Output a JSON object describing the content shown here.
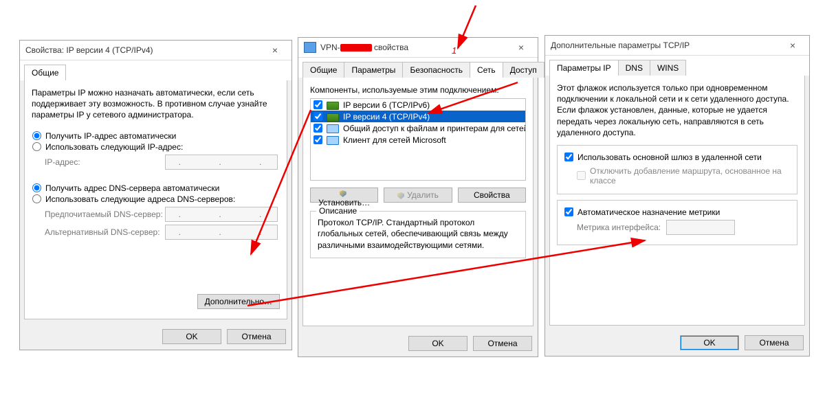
{
  "dlg1": {
    "title": "Свойства: IP версии 4 (TCP/IPv4)",
    "tabs": {
      "general": "Общие"
    },
    "intro": "Параметры IP можно назначать автоматически, если сеть поддерживает эту возможность. В противном случае узнайте параметры IP у сетевого администратора.",
    "r_ip_auto": "Получить IP-адрес автоматически",
    "r_ip_manual": "Использовать следующий IP-адрес:",
    "f_ip": "IP-адрес:",
    "r_dns_auto": "Получить адрес DNS-сервера автоматически",
    "r_dns_manual": "Использовать следующие адреса DNS-серверов:",
    "f_dns1": "Предпочитаемый DNS-сервер:",
    "f_dns2": "Альтернативный DNS-сервер:",
    "ip_placeholder": ".       .       .",
    "btn_adv": "Дополнительно…",
    "btn_ok": "OK",
    "btn_cancel": "Отмена"
  },
  "dlg2": {
    "title_prefix": "VPN-",
    "title_suffix": " свойства",
    "tabs": [
      "Общие",
      "Параметры",
      "Безопасность",
      "Сеть",
      "Доступ"
    ],
    "active_tab": 3,
    "components_label": "Компоненты, используемые этим подключением:",
    "items": [
      {
        "label": "IP версии 6 (TCP/IPv6)",
        "checked": true,
        "icon": "net"
      },
      {
        "label": "IP версии 4 (TCP/IPv4)",
        "checked": true,
        "icon": "net",
        "selected": true
      },
      {
        "label": "Общий доступ к файлам и принтерам для сетей Micr…",
        "checked": true,
        "icon": "mon"
      },
      {
        "label": "Клиент для сетей Microsoft",
        "checked": true,
        "icon": "mon"
      }
    ],
    "btn_install": "Установить…",
    "btn_remove": "Удалить",
    "btn_props": "Свойства",
    "desc_legend": "Описание",
    "desc_text": "Протокол TCP/IP. Стандартный протокол глобальных сетей, обеспечивающий связь между различными взаимодействующими сетями.",
    "btn_ok": "OK",
    "btn_cancel": "Отмена"
  },
  "dlg3": {
    "title": "Дополнительные параметры TCP/IP",
    "tabs": [
      "Параметры IP",
      "DNS",
      "WINS"
    ],
    "active_tab": 0,
    "intro": "Этот флажок используется только при одновременном подключении к локальной сети и к сети удаленного доступа. Если флажок установлен, данные, которые не удается передать через локальную сеть, направляются в сеть удаленного доступа.",
    "c_gateway": "Использовать основной шлюз в удаленной сети",
    "c_classroute": "Отключить добавление маршрута, основанное на классе",
    "c_autometric": "Автоматическое назначение метрики",
    "f_metric": "Метрика интерфейса:",
    "btn_ok": "OK",
    "btn_cancel": "Отмена"
  },
  "annotation": {
    "label1": "1"
  }
}
